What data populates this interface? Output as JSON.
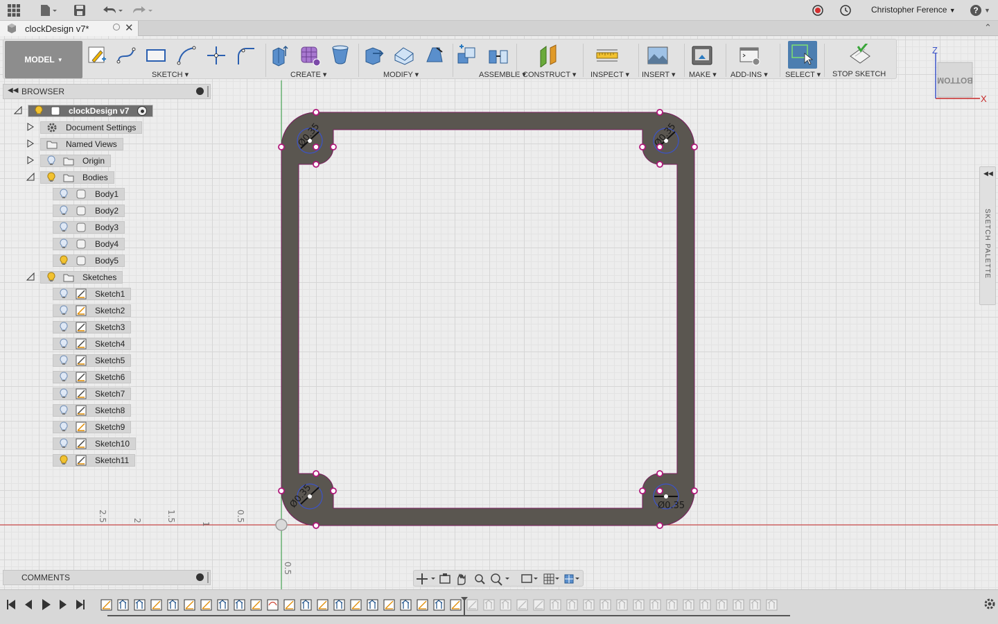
{
  "topbar": {
    "user_name": "Christopher Ference",
    "help_label": "?"
  },
  "document": {
    "tab_title": "clockDesign v7*"
  },
  "toolbar": {
    "workspace": "MODEL",
    "groups": {
      "sketch": "SKETCH",
      "create": "CREATE",
      "modify": "MODIFY",
      "assemble": "ASSEMBLE",
      "construct": "CONSTRUCT",
      "inspect": "INSPECT",
      "insert": "INSERT",
      "make": "MAKE",
      "addins": "ADD-INS",
      "select": "SELECT",
      "stop_sketch": "STOP SKETCH"
    }
  },
  "browser": {
    "title": "BROWSER",
    "root": "clockDesign v7",
    "items": {
      "document_settings": "Document Settings",
      "named_views": "Named Views",
      "origin": "Origin",
      "bodies": "Bodies",
      "sketches": "Sketches"
    },
    "bodies": [
      "Body1",
      "Body2",
      "Body3",
      "Body4",
      "Body5"
    ],
    "sketches": [
      "Sketch1",
      "Sketch2",
      "Sketch3",
      "Sketch4",
      "Sketch5",
      "Sketch6",
      "Sketch7",
      "Sketch8",
      "Sketch9",
      "Sketch10",
      "Sketch11"
    ]
  },
  "comments": {
    "title": "COMMENTS"
  },
  "palette": {
    "title": "SKETCH PALETTE"
  },
  "viewcube": {
    "face": "BOTTOM",
    "axis_z": "Z",
    "axis_x": "X"
  },
  "sketch": {
    "dimensions": [
      "Ø0.35",
      "Ø0.35",
      "Ø0.35",
      "Ø0.35"
    ]
  },
  "rulers": {
    "horizontal": [
      "2.5",
      "2",
      "1.5",
      "1",
      "0.5"
    ],
    "vertical": [
      "0.5"
    ]
  },
  "colors": {
    "body_fill": "#5a5650",
    "constraint": "#b0177a",
    "select_active": "#4c7eb0",
    "x_axis": "#c62828",
    "y_axis": "#2e9e3e"
  }
}
